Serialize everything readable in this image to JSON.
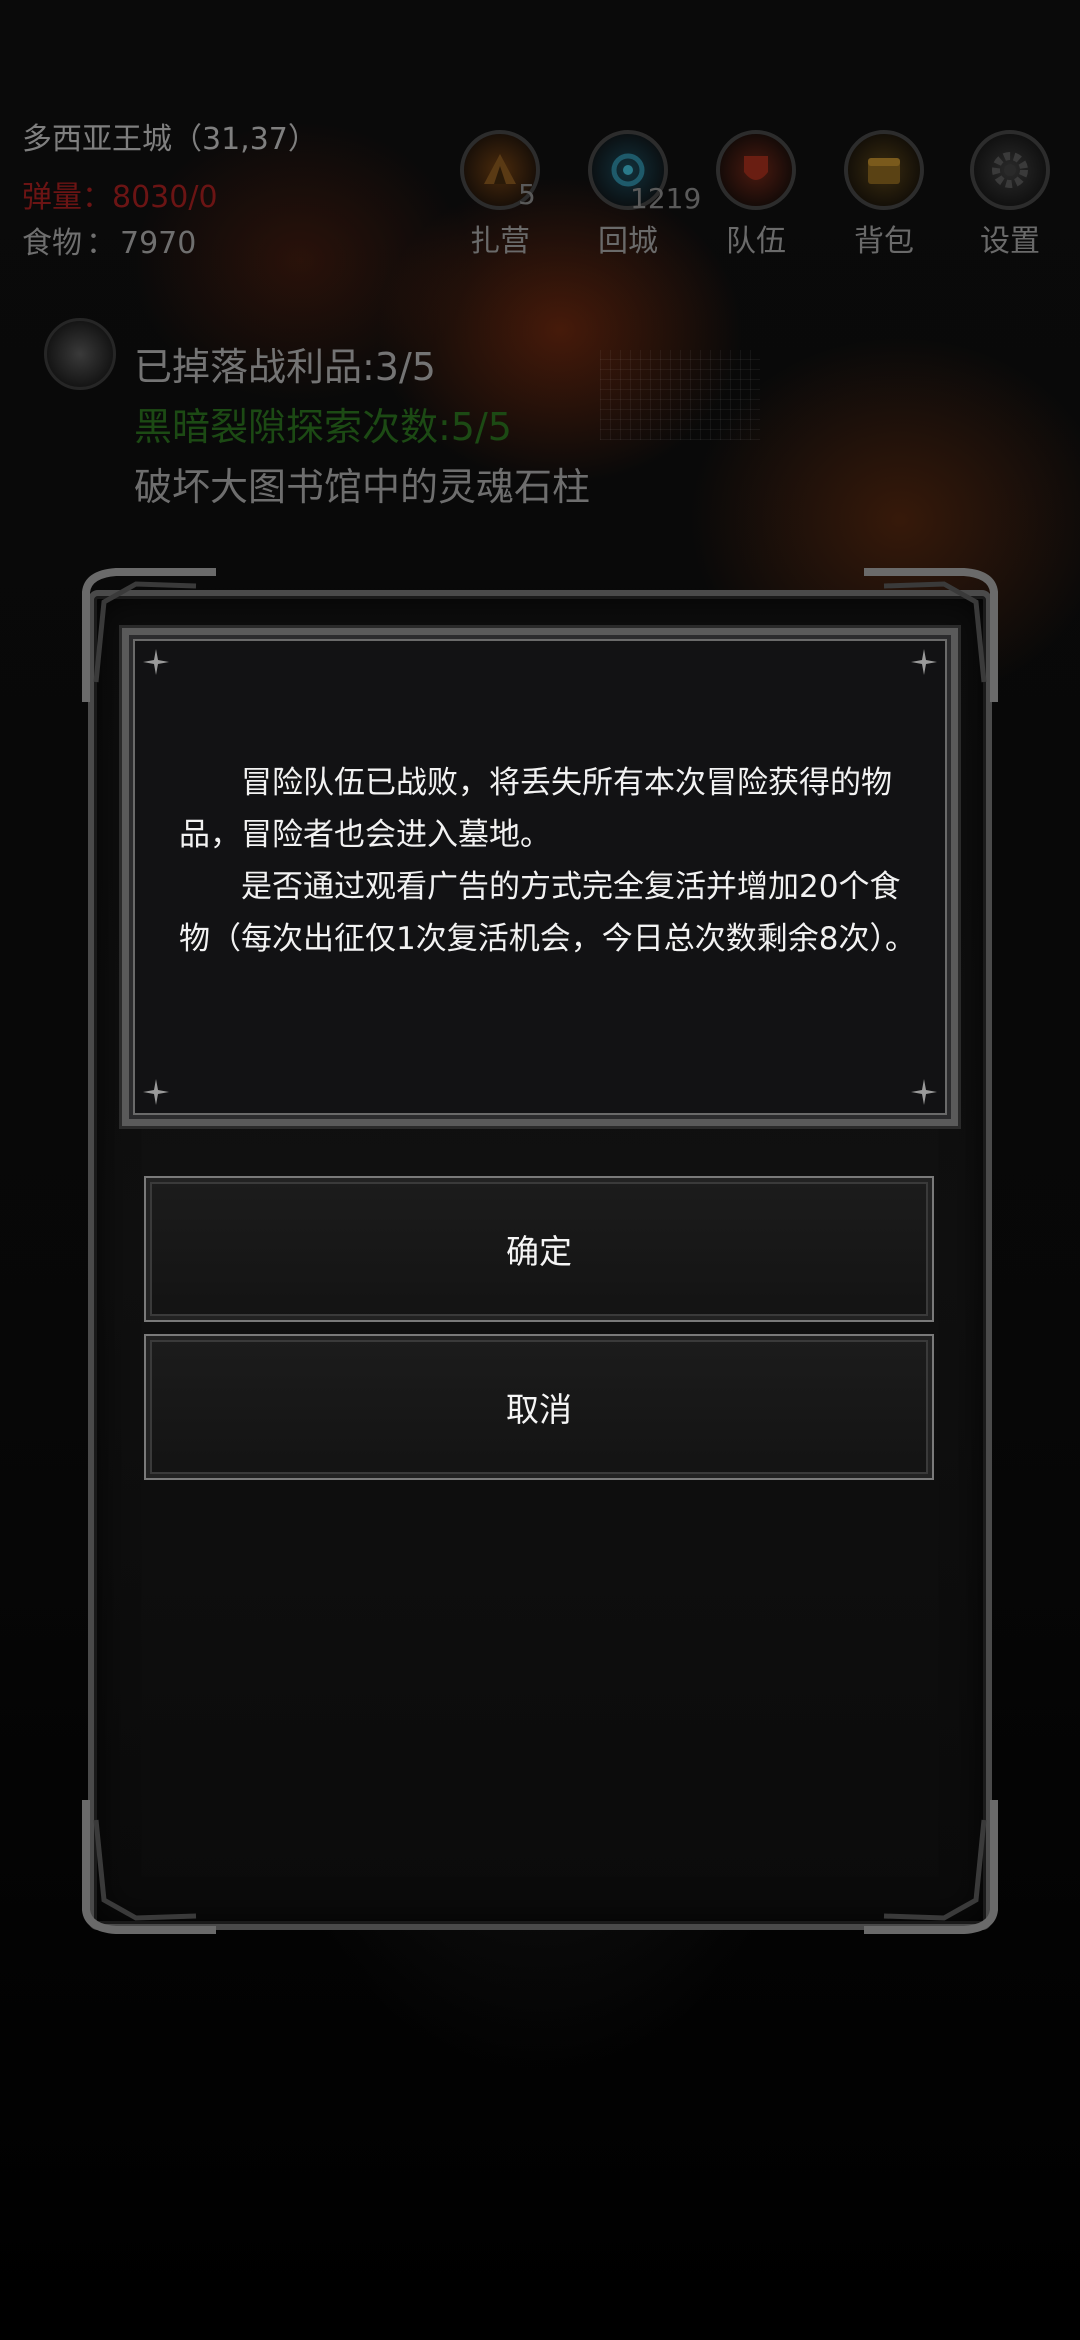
{
  "hud": {
    "city": "多西亚王城（31,37）",
    "ammo": "弹量：8030/0",
    "food_label": "食物",
    "food_sep": "：",
    "food_value": "7970"
  },
  "nav": {
    "camp": {
      "label": "扎营",
      "count": "5",
      "icon": "camp-icon"
    },
    "town": {
      "label": "回城",
      "count": "1219",
      "icon": "portal-icon"
    },
    "team": {
      "label": "队伍",
      "icon": "team-icon"
    },
    "bag": {
      "label": "背包",
      "icon": "chest-icon"
    },
    "settings": {
      "label": "设置",
      "icon": "gear-icon"
    }
  },
  "quest": {
    "loot": "已掉落战利品:3/5",
    "rift": "黑暗裂隙探索次数:5/5",
    "objective": "破坏大图书馆中的灵魂石柱"
  },
  "dialog": {
    "paragraph1": "冒险队伍已战败，将丢失所有本次冒险获得的物品，冒险者也会进入墓地。",
    "paragraph2": "是否通过观看广告的方式完全复活并增加20个食物（每次出征仅1次复活机会，今日总次数剩余8次）。",
    "confirm": "确定",
    "cancel": "取消"
  },
  "colors": {
    "dialog_text": "#f2f2f2",
    "ammo_text": "#6b1414",
    "rift_text": "#1c4a14",
    "frame": "#5a5a5a"
  }
}
